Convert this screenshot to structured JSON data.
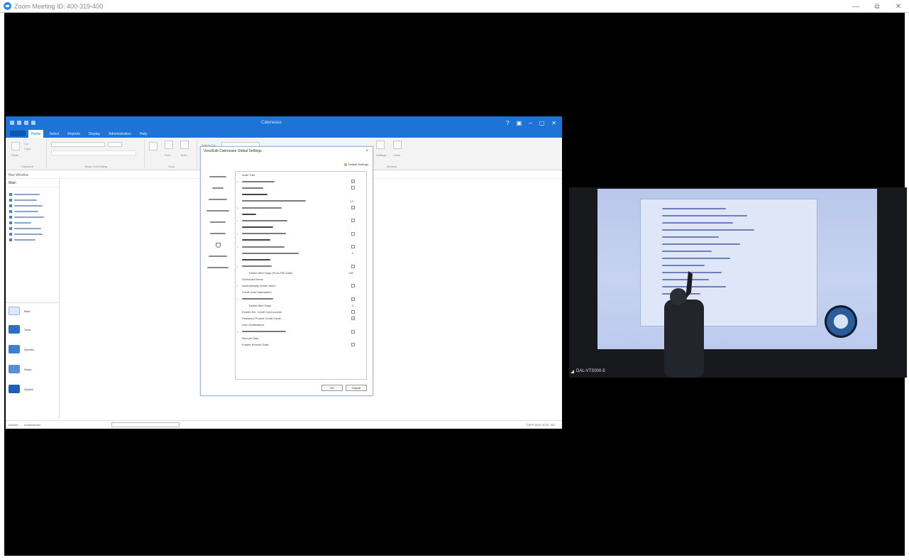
{
  "zoom": {
    "title": "Zoom Meeting ID: 400-319-400",
    "controls": [
      "—",
      "⧉",
      "✕"
    ]
  },
  "app": {
    "title": "Catenease",
    "menu": [
      "Home",
      "Select",
      "Reports",
      "Display",
      "Administration",
      "Help"
    ],
    "ribbon": {
      "paste": "Paste",
      "cut": "Cut",
      "copy": "Copy",
      "clipboard": "Clipboard",
      "basic_text": "Basic Text Editing",
      "tools": "Tools",
      "print": "Print",
      "email": "Email",
      "search_for": "Search For",
      "settings": "Settings",
      "close": "Close",
      "window": "Window"
    },
    "nav_title": "Nav Window",
    "sidebar_head": "Main",
    "big_nav": [
      "Main",
      "Tools",
      "Queries",
      "Setup",
      "System"
    ],
    "status": {
      "left1": "Inactive",
      "left2": "Administrator",
      "right": "CAPS  NUM  SCRL  INS"
    }
  },
  "dialog": {
    "title": "View/Edit Catenease Global Settings",
    "default_settings": "Default Settings",
    "rows": [
      {
        "label": "Audit Trail",
        "type": "head"
      },
      {
        "label": "",
        "bullet": true,
        "cb": "✓"
      },
      {
        "label": "",
        "cb": ""
      },
      {
        "label": "",
        "type": "head"
      },
      {
        "label": "",
        "val": "10"
      },
      {
        "label": "",
        "bullet": true,
        "cb": "✓"
      },
      {
        "label": "",
        "type": "head"
      },
      {
        "label": "",
        "bullet": true,
        "cb": ""
      },
      {
        "label": "",
        "type": "head"
      },
      {
        "label": "",
        "bullet": true,
        "cb": ""
      },
      {
        "label": "",
        "type": "head"
      },
      {
        "label": "",
        "bullet": true,
        "cb": ""
      },
      {
        "label": "",
        "val": "0"
      },
      {
        "label": "",
        "type": "head"
      },
      {
        "label": "",
        "bullet": true,
        "cb": ""
      },
      {
        "label": "Delete After Days (From File Date)",
        "val": "180"
      },
      {
        "label": "Scheduled Items",
        "type": "head"
      },
      {
        "label": "Automatically Delete Items",
        "bullet": true,
        "cb": ""
      },
      {
        "label": "Credit Card Information",
        "type": "head"
      },
      {
        "label": "",
        "bullet": true,
        "cb": "✓"
      },
      {
        "label": "Delete After Days",
        "val": "0"
      },
      {
        "label": "Enable Ext. Credit Card Access",
        "cb": ""
      },
      {
        "label": "Password Protect Credit Cards",
        "cb": "✓"
      },
      {
        "label": "User Notifications",
        "type": "head"
      },
      {
        "label": "",
        "bullet": true,
        "cb": ""
      },
      {
        "label": "Remote Data",
        "type": "head"
      },
      {
        "label": "Enable Remote Data",
        "cb": ""
      }
    ],
    "ok": "OK",
    "cancel": "Cancel"
  },
  "video": {
    "participant": "DAL-VTS000-5"
  }
}
